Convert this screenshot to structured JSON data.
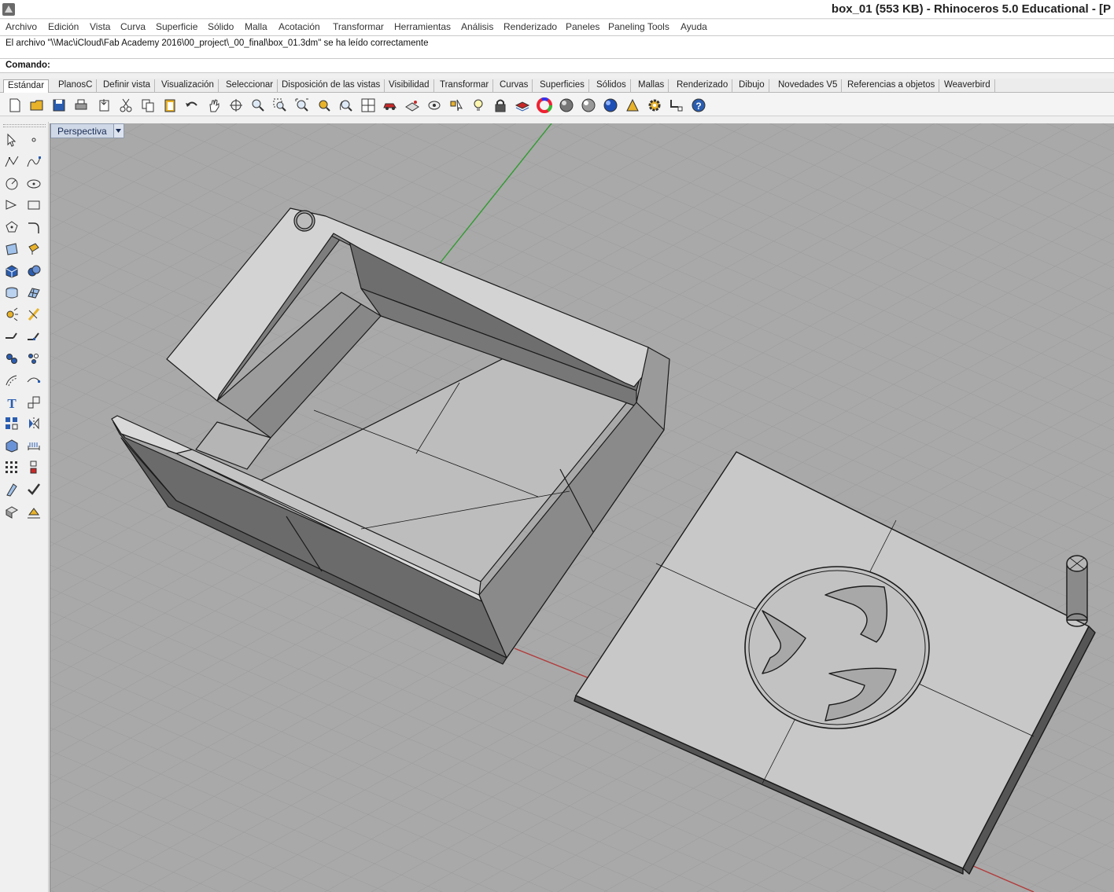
{
  "window": {
    "title": "box_01 (553 KB) - Rhinoceros 5.0 Educational - [P"
  },
  "menu": [
    "Archivo",
    "Edición",
    "Vista",
    "Curva",
    "Superficie",
    "Sólido",
    "Malla",
    "Acotación",
    "Transformar",
    "Herramientas",
    "Análisis",
    "Renderizado",
    "Paneles",
    "Paneling Tools",
    "Ayuda"
  ],
  "command_history": {
    "line": "El archivo \"\\\\Mac\\iCloud\\Fab Academy 2016\\00_project\\_00_final\\box_01.3dm\" se ha leído correctamente"
  },
  "command": {
    "prompt": "Comando:"
  },
  "tabs": [
    "Estándar",
    "PlanosC",
    "Definir vista",
    "Visualización",
    "Seleccionar",
    "Disposición de las vistas",
    "Visibilidad",
    "Transformar",
    "Curvas",
    "Superficies",
    "Sólidos",
    "Mallas",
    "Renderizado",
    "Dibujo",
    "Novedades V5",
    "Referencias a objetos",
    "Weaverbird"
  ],
  "active_tab": "Estándar",
  "toolbar_icons": [
    "new-icon",
    "open-icon",
    "save-icon",
    "print-icon",
    "import-icon",
    "cut-icon",
    "copy-icon",
    "paste-icon",
    "undo-icon",
    "pan-hand-icon",
    "rotate-view-icon",
    "zoom-icon",
    "zoom-window-icon",
    "zoom-extents-icon",
    "zoom-selected-icon",
    "rotate-3d-icon",
    "four-viewports-icon",
    "car-icon",
    "cplane-icon",
    "set-view-icon",
    "select-points-icon",
    "light-bulb-icon",
    "lock-icon",
    "layer-icon",
    "color-wheel-icon",
    "render-sphere-icon",
    "material-sphere-icon",
    "blue-sphere-icon",
    "grasshopper-icon",
    "settings-gear-icon",
    "snap-icon",
    "help-icon"
  ],
  "sidebar_icons": [
    "select-icon",
    "point-icon",
    "polyline-icon",
    "curve-icon",
    "circle-icon",
    "ellipse-icon",
    "arc-icon",
    "rectangle-icon",
    "polygon-icon",
    "fillet-icon",
    "surface-corner-icon",
    "extrude-surface-icon",
    "box-icon",
    "boolean-union-icon",
    "cylinder-icon",
    "mesh-icon",
    "explode-icon",
    "trim-icon",
    "split-icon",
    "join-icon",
    "group-icon",
    "ungroup-icon",
    "offset-icon",
    "blend-icon",
    "text-icon",
    "scale-icon",
    "array-icon",
    "mirror-icon",
    "extrude-box-icon",
    "dimension-icon",
    "grid-array-icon",
    "block-icon",
    "orient-icon",
    "check-icon",
    "shade-icon",
    "paint-icon"
  ],
  "viewport": {
    "label": "Perspectiva"
  },
  "colors": {
    "viewport_bg": "#a8a8a8",
    "grid_line": "#9a9a9a",
    "axis_x": "#b23a3a",
    "axis_y": "#2f9a2f",
    "solid_fill": "#c8c8c8",
    "active_tab": "#ffffff"
  }
}
